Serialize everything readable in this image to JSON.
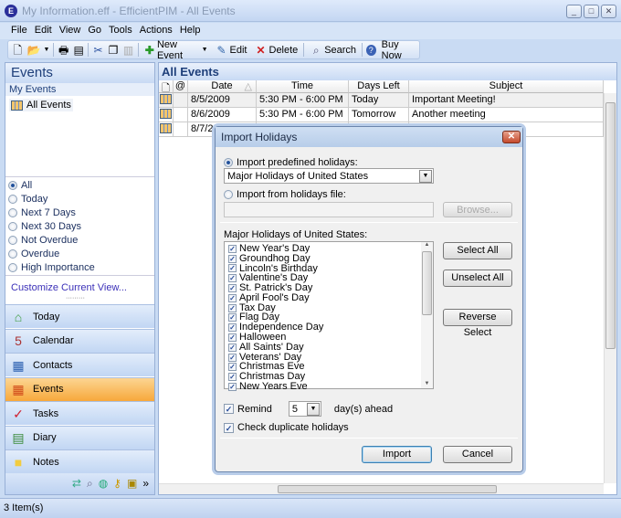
{
  "window": {
    "title": "My Information.eff - EfficientPIM - All Events",
    "app_icon": "E"
  },
  "menu": [
    "File",
    "Edit",
    "View",
    "Go",
    "Tools",
    "Actions",
    "Help"
  ],
  "toolbar": {
    "new_event": "New Event",
    "edit": "Edit",
    "delete": "Delete",
    "search": "Search",
    "buy_now": "Buy Now"
  },
  "left": {
    "title": "Events",
    "section": "My Events",
    "tree_item": "All Events",
    "filters": [
      {
        "label": "All",
        "selected": true
      },
      {
        "label": "Today",
        "selected": false
      },
      {
        "label": "Next 7 Days",
        "selected": false
      },
      {
        "label": "Next 30 Days",
        "selected": false
      },
      {
        "label": "Not Overdue",
        "selected": false
      },
      {
        "label": "Overdue",
        "selected": false
      },
      {
        "label": "High Importance",
        "selected": false
      }
    ],
    "customize": "Customize Current View...",
    "nav": [
      {
        "label": "Today",
        "icon": "house-icon"
      },
      {
        "label": "Calendar",
        "icon": "calendar-icon"
      },
      {
        "label": "Contacts",
        "icon": "contacts-icon"
      },
      {
        "label": "Events",
        "icon": "events-icon",
        "selected": true
      },
      {
        "label": "Tasks",
        "icon": "tasks-icon"
      },
      {
        "label": "Diary",
        "icon": "diary-icon"
      },
      {
        "label": "Notes",
        "icon": "notes-icon"
      }
    ]
  },
  "main": {
    "title": "All Events",
    "columns": [
      "Date",
      "Time",
      "Days Left",
      "Subject"
    ],
    "rows": [
      {
        "date": "8/5/2009",
        "time": "5:30 PM - 6:00 PM",
        "days_left": "Today",
        "subject": "Important Meeting!"
      },
      {
        "date": "8/6/2009",
        "time": "5:30 PM - 6:00 PM",
        "days_left": "Tomorrow",
        "subject": "Another meeting"
      },
      {
        "date": "8/7/20",
        "time": "",
        "days_left": "",
        "subject": ""
      }
    ]
  },
  "status": "3 Item(s)",
  "dialog": {
    "title": "Import Holidays",
    "radio_predefined": "Import predefined holidays:",
    "predefined_value": "Major Holidays of United States",
    "radio_file": "Import from holidays file:",
    "file_value": "",
    "browse": "Browse...",
    "list_label": "Major Holidays of United States:",
    "holidays": [
      "New Year's Day",
      "Groundhog Day",
      "Lincoln's Birthday",
      "Valentine's Day",
      "St. Patrick's Day",
      "April Fool's Day",
      "Tax Day",
      "Flag Day",
      "Independence Day",
      "Halloween",
      "All Saints' Day",
      "Veterans' Day",
      "Christmas Eve",
      "Christmas Day",
      "New Years Eve"
    ],
    "select_all": "Select All",
    "unselect_all": "Unselect All",
    "reverse_select": "Reverse Select",
    "remind": "Remind",
    "remind_days": "5",
    "days_ahead": "day(s) ahead",
    "check_duplicate": "Check duplicate holidays",
    "import": "Import",
    "cancel": "Cancel"
  }
}
